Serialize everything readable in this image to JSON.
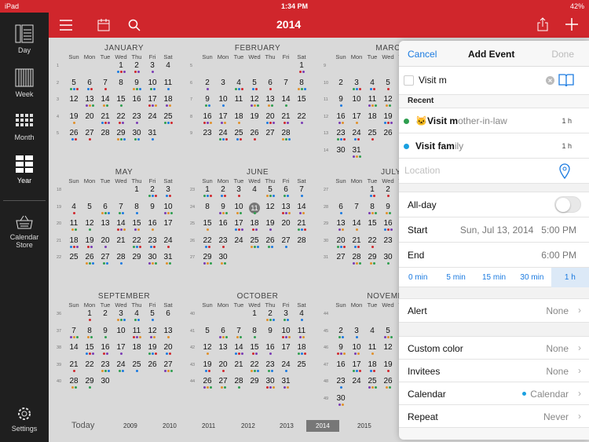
{
  "status": {
    "device": "iPad",
    "time": "1:34 PM",
    "battery": "42%"
  },
  "sidebar": {
    "items": [
      {
        "label": "Day",
        "icon": "day-view-icon"
      },
      {
        "label": "Week",
        "icon": "week-view-icon"
      },
      {
        "label": "Month",
        "icon": "month-view-icon"
      },
      {
        "label": "Year",
        "icon": "year-view-icon"
      },
      {
        "label": "Calendar\nStore",
        "icon": "basket-icon"
      },
      {
        "label": "Settings",
        "icon": "gear-icon"
      }
    ]
  },
  "topbar": {
    "title": "2014"
  },
  "months": [
    {
      "name": "JANUARY",
      "weeks": [
        [
          "1",
          [
            "",
            "",
            "",
            "1",
            "2",
            "3",
            "4"
          ]
        ],
        [
          "2",
          [
            "5",
            "6",
            "7",
            "8",
            "9",
            "10",
            "11"
          ]
        ],
        [
          "3",
          [
            "12",
            "13",
            "14",
            "15",
            "16",
            "17",
            "18"
          ]
        ],
        [
          "4",
          [
            "19",
            "20",
            "21",
            "22",
            "23",
            "24",
            "25"
          ]
        ],
        [
          "5",
          [
            "26",
            "27",
            "28",
            "29",
            "30",
            "31",
            ""
          ]
        ]
      ]
    },
    {
      "name": "FEBRUARY",
      "weeks": [
        [
          "5",
          [
            "",
            "",
            "",
            "",
            "",
            "",
            "1"
          ]
        ],
        [
          "6",
          [
            "2",
            "3",
            "4",
            "5",
            "6",
            "7",
            "8"
          ]
        ],
        [
          "7",
          [
            "9",
            "10",
            "11",
            "12",
            "13",
            "14",
            "15"
          ]
        ],
        [
          "8",
          [
            "16",
            "17",
            "18",
            "19",
            "20",
            "21",
            "22"
          ]
        ],
        [
          "9",
          [
            "23",
            "24",
            "25",
            "26",
            "27",
            "28",
            ""
          ]
        ]
      ]
    },
    {
      "name": "MARCH",
      "weeks": [
        [
          "9",
          [
            "",
            "",
            "",
            "",
            "",
            "",
            ""
          ]
        ],
        [
          "10",
          [
            "2",
            "3",
            "4",
            "5",
            "6",
            "7",
            "8"
          ]
        ],
        [
          "11",
          [
            "9",
            "10",
            "11",
            "12",
            "13",
            "14",
            "15"
          ]
        ],
        [
          "12",
          [
            "16",
            "17",
            "18",
            "19",
            "20",
            "21",
            "22"
          ]
        ],
        [
          "13",
          [
            "23",
            "24",
            "25",
            "26",
            "27",
            "28",
            "29"
          ]
        ],
        [
          "14",
          [
            "30",
            "31",
            "",
            "",
            "",
            "",
            ""
          ]
        ]
      ]
    },
    {
      "name": "MAY",
      "weeks": [
        [
          "18",
          [
            "",
            "",
            "",
            "",
            "1",
            "2",
            "3"
          ]
        ],
        [
          "19",
          [
            "4",
            "5",
            "6",
            "7",
            "8",
            "9",
            "10"
          ]
        ],
        [
          "20",
          [
            "11",
            "12",
            "13",
            "14",
            "15",
            "16",
            "17"
          ]
        ],
        [
          "21",
          [
            "18",
            "19",
            "20",
            "21",
            "22",
            "23",
            "24"
          ]
        ],
        [
          "22",
          [
            "25",
            "26",
            "27",
            "28",
            "29",
            "30",
            "31"
          ]
        ]
      ]
    },
    {
      "name": "JUNE",
      "weeks": [
        [
          "23",
          [
            "1",
            "2",
            "3",
            "4",
            "5",
            "6",
            "7"
          ]
        ],
        [
          "24",
          [
            "8",
            "9",
            "10",
            "11",
            "12",
            "13",
            "14"
          ]
        ],
        [
          "25",
          [
            "15",
            "16",
            "17",
            "18",
            "19",
            "20",
            "21"
          ]
        ],
        [
          "26",
          [
            "22",
            "23",
            "24",
            "25",
            "26",
            "27",
            "28"
          ]
        ],
        [
          "27",
          [
            "29",
            "30",
            "",
            "",
            "",
            "",
            ""
          ]
        ]
      ]
    },
    {
      "name": "JULY",
      "weeks": [
        [
          "27",
          [
            "",
            "",
            "1",
            "2",
            "3",
            "4",
            "5"
          ]
        ],
        [
          "28",
          [
            "6",
            "7",
            "8",
            "9",
            "10",
            "11",
            "12"
          ]
        ],
        [
          "29",
          [
            "13",
            "14",
            "15",
            "16",
            "17",
            "18",
            "19"
          ]
        ],
        [
          "30",
          [
            "20",
            "21",
            "22",
            "23",
            "24",
            "25",
            "26"
          ]
        ],
        [
          "31",
          [
            "27",
            "28",
            "29",
            "30",
            "31",
            "",
            ""
          ]
        ]
      ]
    },
    {
      "name": "SEPTEMBER",
      "weeks": [
        [
          "36",
          [
            "",
            "1",
            "2",
            "3",
            "4",
            "5",
            "6"
          ]
        ],
        [
          "37",
          [
            "7",
            "8",
            "9",
            "10",
            "11",
            "12",
            "13"
          ]
        ],
        [
          "38",
          [
            "14",
            "15",
            "16",
            "17",
            "18",
            "19",
            "20"
          ]
        ],
        [
          "39",
          [
            "21",
            "22",
            "23",
            "24",
            "25",
            "26",
            "27"
          ]
        ],
        [
          "40",
          [
            "28",
            "29",
            "30",
            "",
            "",
            "",
            ""
          ]
        ]
      ]
    },
    {
      "name": "OCTOBER",
      "weeks": [
        [
          "40",
          [
            "",
            "",
            "",
            "1",
            "2",
            "3",
            "4"
          ]
        ],
        [
          "41",
          [
            "5",
            "6",
            "7",
            "8",
            "9",
            "10",
            "11"
          ]
        ],
        [
          "42",
          [
            "12",
            "13",
            "14",
            "15",
            "16",
            "17",
            "18"
          ]
        ],
        [
          "43",
          [
            "19",
            "20",
            "21",
            "22",
            "23",
            "24",
            "25"
          ]
        ],
        [
          "44",
          [
            "26",
            "27",
            "28",
            "29",
            "30",
            "31",
            ""
          ]
        ]
      ]
    },
    {
      "name": "NOVEMBER",
      "weeks": [
        [
          "44",
          [
            "",
            "",
            "",
            "",
            "",
            "",
            ""
          ]
        ],
        [
          "45",
          [
            "2",
            "3",
            "4",
            "5",
            "6",
            "7",
            "8"
          ]
        ],
        [
          "46",
          [
            "9",
            "10",
            "11",
            "12",
            "13",
            "14",
            "15"
          ]
        ],
        [
          "47",
          [
            "16",
            "17",
            "18",
            "19",
            "20",
            "21",
            "22"
          ]
        ],
        [
          "48",
          [
            "23",
            "24",
            "25",
            "26",
            "27",
            "28",
            "29"
          ]
        ],
        [
          "49",
          [
            "30",
            "",
            "",
            "",
            "",
            "",
            ""
          ]
        ]
      ]
    }
  ],
  "dow": [
    "Sun",
    "Mon",
    "Tue",
    "Wed",
    "Thu",
    "Fri",
    "Sat"
  ],
  "today_day": "11",
  "dot_colors": [
    "#2e9e4f",
    "#1a7ae0",
    "#d0262c",
    "#7a3bb5",
    "#e0902a"
  ],
  "yearbar": {
    "today": "Today",
    "years": [
      "2009",
      "2010",
      "2011",
      "2012",
      "2013",
      "2014",
      "2015"
    ],
    "current": "2014"
  },
  "event": {
    "header": {
      "cancel": "Cancel",
      "title": "Add Event",
      "done": "Done"
    },
    "title_value": "Visit m",
    "recent_label": "Recent",
    "recent": [
      {
        "bold": "Visit m",
        "rest": "other-in-law",
        "emoji": "🐱",
        "duration": "1 h",
        "color": "#2e9e4f"
      },
      {
        "bold": "Visit fa",
        "mid": "m",
        "rest": "ily",
        "duration": "1 h",
        "color": "#1aa0e0"
      }
    ],
    "location_placeholder": "Location",
    "allday_label": "All-day",
    "start_label": "Start",
    "start_value": "Sun, Jul 13, 2014   5:00 PM",
    "end_label": "End",
    "end_value": "6:00 PM",
    "durations": [
      "0 min",
      "5 min",
      "15 min",
      "30 min",
      "1 h"
    ],
    "alert_label": "Alert",
    "alert_value": "None",
    "color_label": "Custom color",
    "color_value": "None",
    "invitees_label": "Invitees",
    "invitees_value": "None",
    "calendar_label": "Calendar",
    "calendar_value": "Calendar",
    "repeat_label": "Repeat",
    "repeat_value": "Never"
  }
}
